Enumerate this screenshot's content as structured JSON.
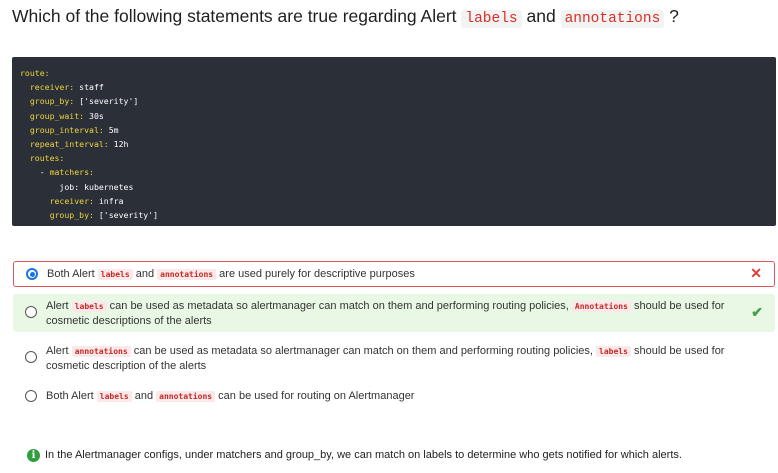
{
  "question": {
    "prefix": "Which of the following statements are true regarding Alert ",
    "code1": "labels",
    "mid": " and ",
    "code2": "annotations",
    "suffix": " ?"
  },
  "code": {
    "l1k": "route:",
    "l2k": "  receiver:",
    "l2v": " staff",
    "l3k": "  group_by:",
    "l3v": " ['severity']",
    "l4k": "  group_wait:",
    "l4v": " 30s",
    "l5k": "  group_interval:",
    "l5v": " 5m",
    "l6k": "  repeat_interval:",
    "l6v": " 12h",
    "l7k": "  routes:",
    "l8v": "    - ",
    "l8k": "matchers:",
    "l9v": "        job: kubernetes",
    "l10k": "      receiver:",
    "l10v": " infra",
    "l11k": "      group_by:",
    "l11v": " ['severity']"
  },
  "options": [
    {
      "t1": "Both Alert ",
      "c1": "labels",
      "t2": " and ",
      "c2": "annotations",
      "t3": " are used purely for descriptive purposes",
      "mark": "✕"
    },
    {
      "t1": "Alert ",
      "c1": "labels",
      "t2": " can be used as metadata so alertmanager can match on them and performing routing policies, ",
      "c2": "Annotations",
      "t3": " should be used for cosmetic descriptions of the alerts",
      "mark": "✔"
    },
    {
      "t1": "Alert ",
      "c1": "annotations",
      "t2": " can be used as metadata so alertmanager can match on them and performing routing policies, ",
      "c2": "labels",
      "t3": " should be used for cosmetic description of the alerts"
    },
    {
      "t1": "Both Alert ",
      "c1": "labels",
      "t2": " and ",
      "c2": "annotations",
      "t3": " can be used for routing on Alertmanager"
    }
  ],
  "explanation": {
    "icon": "i",
    "text": "In the Alertmanager configs, under matchers and group_by, we can match on labels to determine who gets notified for which alerts."
  }
}
